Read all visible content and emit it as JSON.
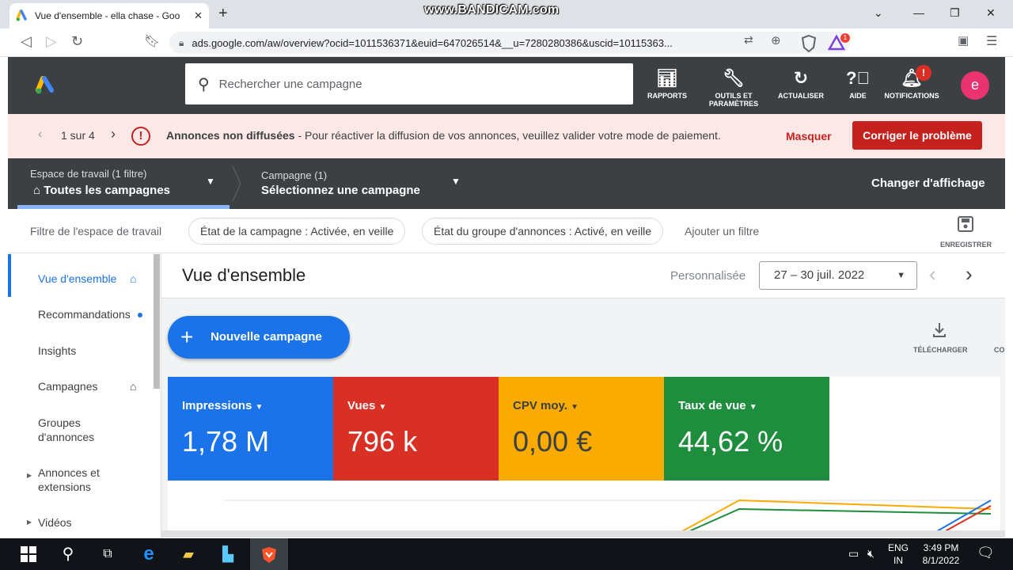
{
  "watermark": "www.BANDICAM.com",
  "browser": {
    "tab_title": "Vue d'ensemble - ella chase - Goo",
    "url": "ads.google.com/aw/overview?ocid=1011536371&euid=647026514&__u=7280280386&uscid=10115363...",
    "shield_badge": "1"
  },
  "header": {
    "search_placeholder": "Rechercher une campagne",
    "buttons": [
      {
        "label": "RAPPORTS",
        "icon": "reports-icon"
      },
      {
        "label": "OUTILS ET PARAMÈTRES",
        "icon": "tools-icon"
      },
      {
        "label": "ACTUALISER",
        "icon": "refresh-icon"
      },
      {
        "label": "AIDE",
        "icon": "help-icon"
      },
      {
        "label": "NOTIFICATIONS",
        "icon": "bell-icon"
      }
    ],
    "notif_badge": "!",
    "avatar_letter": "e"
  },
  "alert": {
    "pager": "1 sur 4",
    "title": "Annonces non diffusées",
    "message": " - Pour réactiver la diffusion de vos annonces, veuillez valider votre mode de paiement.",
    "dismiss": "Masquer",
    "fix": "Corriger le problème"
  },
  "workspace": {
    "ws_label": "Espace de travail (1 filtre)",
    "ws_value": "Toutes les campagnes",
    "camp_label": "Campagne (1)",
    "camp_value": "Sélectionnez une campagne",
    "change_view": "Changer d'affichage"
  },
  "filters": {
    "label": "Filtre de l'espace de travail",
    "chips": [
      "État de la campagne : Activée, en veille",
      "État du groupe d'annonces : Activé, en veille"
    ],
    "add": "Ajouter un filtre",
    "save": "ENREGISTRER"
  },
  "sidebar": {
    "items": [
      {
        "label": "Vue d'ensemble"
      },
      {
        "label": "Recommandations"
      },
      {
        "label": "Insights"
      },
      {
        "label": "Campagnes"
      },
      {
        "label": "Groupes d'annonces"
      },
      {
        "label": "Annonces et extensions"
      },
      {
        "label": "Vidéos"
      }
    ]
  },
  "main": {
    "title": "Vue d'ensemble",
    "date_mode": "Personnalisée",
    "date_range": "27 – 30 juil. 2022",
    "new_campaign": "Nouvelle campagne",
    "download": "TÉLÉCHARGER",
    "download_cut": "CO",
    "metrics": [
      {
        "label": "Impressions",
        "value": "1,78 M",
        "color": "#1a73e8",
        "fg": "#ffffff"
      },
      {
        "label": "Vues",
        "value": "796 k",
        "color": "#d93025",
        "fg": "#ffffff"
      },
      {
        "label": "CPV moy.",
        "value": "0,00 €",
        "color": "#f9ab00",
        "fg": "#3c4043"
      },
      {
        "label": "Taux de vue",
        "value": "44,62 %",
        "color": "#1e8e3e",
        "fg": "#ffffff"
      }
    ]
  },
  "taskbar": {
    "lang1": "ENG",
    "lang2": "IN",
    "time": "3:49 PM",
    "date": "8/1/2022"
  }
}
